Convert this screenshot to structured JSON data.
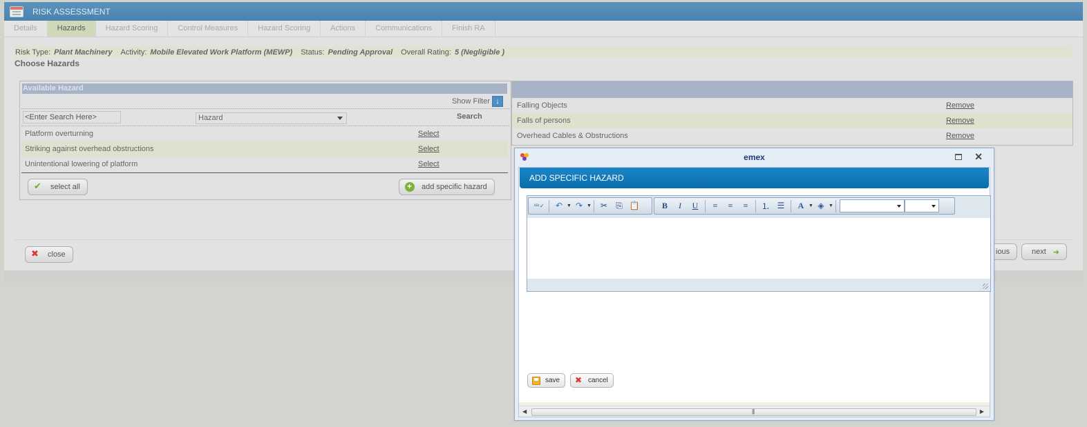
{
  "app": {
    "title": "RISK ASSESSMENT",
    "tabs": [
      "Details",
      "Hazards",
      "Hazard Scoring",
      "Control Measures",
      "Hazard Scoring",
      "Actions",
      "Communications",
      "Finish RA"
    ],
    "active_tab": "Hazards"
  },
  "info": {
    "risk_type_label": "Risk Type:",
    "risk_type_value": "Plant Machinery",
    "activity_label": "Activity:",
    "activity_value": "Mobile Elevated Work Platform (MEWP)",
    "status_label": "Status:",
    "status_value": "Pending Approval",
    "rating_label": "Overall Rating:",
    "rating_value": "5 (Negligible )"
  },
  "section_title": "Choose Hazards",
  "available": {
    "header": "Available Hazard",
    "show_filter": "Show Filter",
    "search_placeholder": "<Enter Search Here>",
    "hazard_select": "Hazard",
    "search_label": "Search",
    "rows": [
      {
        "name": "Platform overturning",
        "action": "Select"
      },
      {
        "name": "Striking against overhead obstructions",
        "action": "Select"
      },
      {
        "name": "Unintentional lowering of platform",
        "action": "Select"
      }
    ],
    "select_all": "select all",
    "add_specific": "add specific hazard"
  },
  "selected": {
    "rows": [
      {
        "name": "Falling Objects",
        "action": "Remove"
      },
      {
        "name": "Falls of persons",
        "action": "Remove"
      },
      {
        "name": "Overhead Cables & Obstructions",
        "action": "Remove"
      }
    ]
  },
  "footer": {
    "close": "close",
    "previous_partial": "ious",
    "next": "next"
  },
  "modal": {
    "window_title": "emex",
    "header": "ADD SPECIFIC HAZARD",
    "editor_content": "",
    "save": "save",
    "cancel": "cancel"
  },
  "colors": {
    "title_bar": "#4a83ad",
    "active_tab": "#cfd8b8",
    "modal_header": "#0a6eac",
    "panel_header": "#a6b3c7"
  }
}
